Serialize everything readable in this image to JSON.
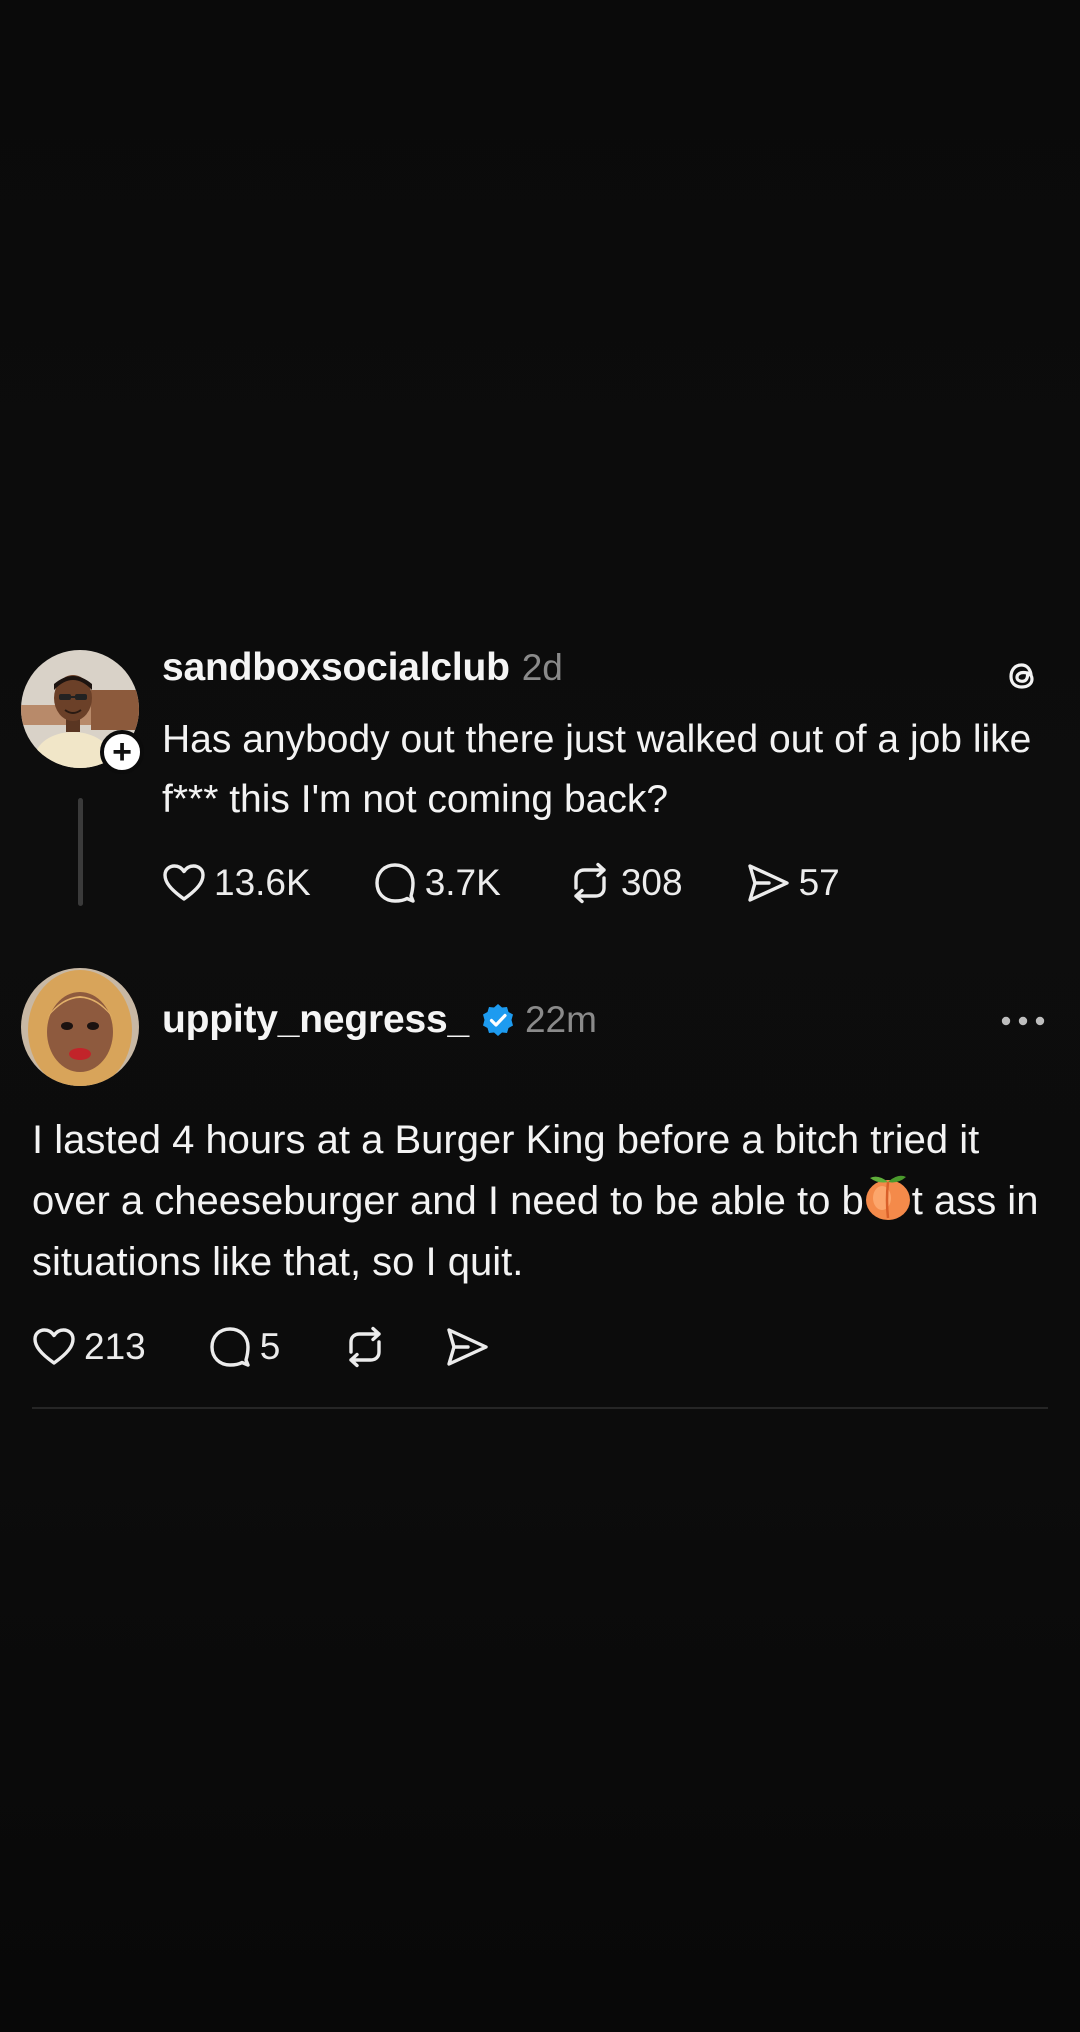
{
  "post": {
    "username": "sandboxsocialclub",
    "time": "2d",
    "text": "Has anybody out there just walked out of a job like f*** this I'm not coming back?",
    "follow_badge": "+",
    "stats": {
      "likes": "13.6K",
      "replies": "3.7K",
      "reposts": "308",
      "shares": "57"
    }
  },
  "reply": {
    "username": "uppity_negress_",
    "time": "22m",
    "text_before": "I lasted 4 hours at a Burger King before a bitch tried it over a cheeseburger and I need to be able to b",
    "text_emoji": "peach",
    "text_after": "t ass in situations like that, so I quit.",
    "stats": {
      "likes": "213",
      "replies": "5"
    }
  },
  "colors": {
    "background": "#0b0b0b",
    "text": "#f3f3f3",
    "muted": "#8a8a8a",
    "verified": "#1d9bf0",
    "divider": "#262626"
  },
  "icons": {
    "threads": "threads-logo-icon",
    "like": "heart-icon",
    "reply": "speech-bubble-icon",
    "repost": "repost-icon",
    "share": "send-icon",
    "more": "more-horizontal-icon",
    "verified": "verified-badge-icon"
  }
}
